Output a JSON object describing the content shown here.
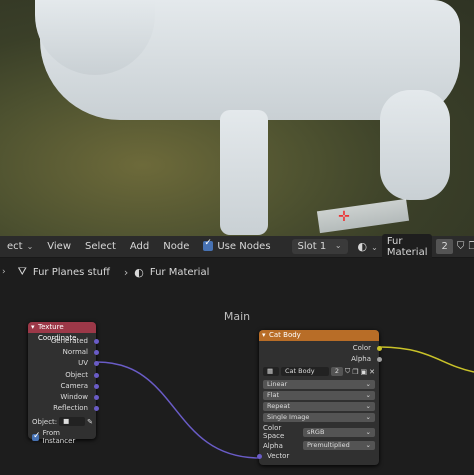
{
  "header": {
    "mode_label": "ect",
    "menus": [
      "View",
      "Select",
      "Add",
      "Node"
    ],
    "use_nodes_label": "Use Nodes",
    "slot_label": "Slot 1",
    "material_name": "Fur Material",
    "user_count": "2"
  },
  "breadcrumb": {
    "object": "Fur Planes stuff",
    "material": "Fur Material"
  },
  "canvas": {
    "title": "Main"
  },
  "texture_node": {
    "title": "Texture Coordinate",
    "outputs": [
      "Generated",
      "Normal",
      "UV",
      "Object",
      "Camera",
      "Window",
      "Reflection"
    ],
    "object_label": "Object:",
    "from_instancer_label": "From Instancer",
    "color": "#9c3848"
  },
  "image_node": {
    "title": "Cat Body",
    "outputs": [
      "Color",
      "Alpha"
    ],
    "image_name": "Cat Body",
    "image_users": "2",
    "interpolation": "Linear",
    "projection": "Flat",
    "extension": "Repeat",
    "source": "Single Image",
    "color_space_label": "Color Space",
    "color_space": "sRGB",
    "alpha_label": "Alpha",
    "alpha_mode": "Premultiplied",
    "vector_input": "Vector",
    "color": "#b86d27"
  }
}
